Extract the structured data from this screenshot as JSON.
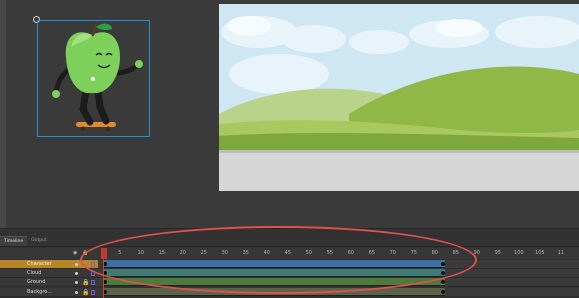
{
  "panel_tabs": [
    "Timeline",
    "Output"
  ],
  "ruler": {
    "frame_labels": [
      "5",
      "10",
      "15",
      "20",
      "25",
      "30",
      "35",
      "40",
      "45",
      "50",
      "55",
      "60",
      "65",
      "70",
      "75",
      "80",
      "85",
      "90",
      "95",
      "100",
      "105",
      "11"
    ],
    "current_frame": 1
  },
  "layers": [
    {
      "name": "Character",
      "selected": true,
      "tween_color": "#3d6fa6"
    },
    {
      "name": "Cloud",
      "selected": false,
      "tween_color": "#3f7a75"
    },
    {
      "name": "Ground",
      "selected": false,
      "tween_color": "#4f7a3d"
    },
    {
      "name": "Backgro...",
      "selected": false,
      "tween_color": "#5a6248"
    }
  ],
  "colors": {
    "selected_layer": "#b7862a",
    "symbol_outline": "#1f8fd6",
    "highlight_ring": "#e0524e",
    "playhead": "#e03a2f"
  }
}
